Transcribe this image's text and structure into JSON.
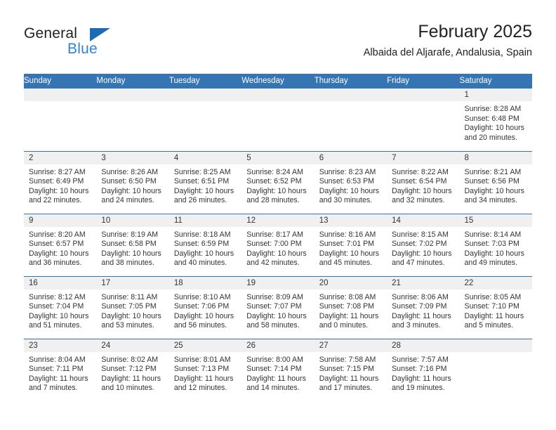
{
  "brand": {
    "name_dark": "General",
    "name_blue": "Blue",
    "accent_blue": "#3575b4",
    "logo_blue": "#2e83d2"
  },
  "header": {
    "title": "February 2025",
    "subtitle": "Albaida del Aljarafe, Andalusia, Spain"
  },
  "weekday_headers": [
    "Sunday",
    "Monday",
    "Tuesday",
    "Wednesday",
    "Thursday",
    "Friday",
    "Saturday"
  ],
  "labels": {
    "sunrise_prefix": "Sunrise:",
    "sunset_prefix": "Sunset:",
    "daylight_prefix": "Daylight:"
  },
  "weeks": [
    [
      {
        "day": "",
        "empty": true
      },
      {
        "day": "",
        "empty": true
      },
      {
        "day": "",
        "empty": true
      },
      {
        "day": "",
        "empty": true
      },
      {
        "day": "",
        "empty": true
      },
      {
        "day": "",
        "empty": true
      },
      {
        "day": "1",
        "sunrise": "Sunrise: 8:28 AM",
        "sunset": "Sunset: 6:48 PM",
        "daylight": "Daylight: 10 hours and 20 minutes."
      }
    ],
    [
      {
        "day": "2",
        "sunrise": "Sunrise: 8:27 AM",
        "sunset": "Sunset: 6:49 PM",
        "daylight": "Daylight: 10 hours and 22 minutes."
      },
      {
        "day": "3",
        "sunrise": "Sunrise: 8:26 AM",
        "sunset": "Sunset: 6:50 PM",
        "daylight": "Daylight: 10 hours and 24 minutes."
      },
      {
        "day": "4",
        "sunrise": "Sunrise: 8:25 AM",
        "sunset": "Sunset: 6:51 PM",
        "daylight": "Daylight: 10 hours and 26 minutes."
      },
      {
        "day": "5",
        "sunrise": "Sunrise: 8:24 AM",
        "sunset": "Sunset: 6:52 PM",
        "daylight": "Daylight: 10 hours and 28 minutes."
      },
      {
        "day": "6",
        "sunrise": "Sunrise: 8:23 AM",
        "sunset": "Sunset: 6:53 PM",
        "daylight": "Daylight: 10 hours and 30 minutes."
      },
      {
        "day": "7",
        "sunrise": "Sunrise: 8:22 AM",
        "sunset": "Sunset: 6:54 PM",
        "daylight": "Daylight: 10 hours and 32 minutes."
      },
      {
        "day": "8",
        "sunrise": "Sunrise: 8:21 AM",
        "sunset": "Sunset: 6:56 PM",
        "daylight": "Daylight: 10 hours and 34 minutes."
      }
    ],
    [
      {
        "day": "9",
        "sunrise": "Sunrise: 8:20 AM",
        "sunset": "Sunset: 6:57 PM",
        "daylight": "Daylight: 10 hours and 36 minutes."
      },
      {
        "day": "10",
        "sunrise": "Sunrise: 8:19 AM",
        "sunset": "Sunset: 6:58 PM",
        "daylight": "Daylight: 10 hours and 38 minutes."
      },
      {
        "day": "11",
        "sunrise": "Sunrise: 8:18 AM",
        "sunset": "Sunset: 6:59 PM",
        "daylight": "Daylight: 10 hours and 40 minutes."
      },
      {
        "day": "12",
        "sunrise": "Sunrise: 8:17 AM",
        "sunset": "Sunset: 7:00 PM",
        "daylight": "Daylight: 10 hours and 42 minutes."
      },
      {
        "day": "13",
        "sunrise": "Sunrise: 8:16 AM",
        "sunset": "Sunset: 7:01 PM",
        "daylight": "Daylight: 10 hours and 45 minutes."
      },
      {
        "day": "14",
        "sunrise": "Sunrise: 8:15 AM",
        "sunset": "Sunset: 7:02 PM",
        "daylight": "Daylight: 10 hours and 47 minutes."
      },
      {
        "day": "15",
        "sunrise": "Sunrise: 8:14 AM",
        "sunset": "Sunset: 7:03 PM",
        "daylight": "Daylight: 10 hours and 49 minutes."
      }
    ],
    [
      {
        "day": "16",
        "sunrise": "Sunrise: 8:12 AM",
        "sunset": "Sunset: 7:04 PM",
        "daylight": "Daylight: 10 hours and 51 minutes."
      },
      {
        "day": "17",
        "sunrise": "Sunrise: 8:11 AM",
        "sunset": "Sunset: 7:05 PM",
        "daylight": "Daylight: 10 hours and 53 minutes."
      },
      {
        "day": "18",
        "sunrise": "Sunrise: 8:10 AM",
        "sunset": "Sunset: 7:06 PM",
        "daylight": "Daylight: 10 hours and 56 minutes."
      },
      {
        "day": "19",
        "sunrise": "Sunrise: 8:09 AM",
        "sunset": "Sunset: 7:07 PM",
        "daylight": "Daylight: 10 hours and 58 minutes."
      },
      {
        "day": "20",
        "sunrise": "Sunrise: 8:08 AM",
        "sunset": "Sunset: 7:08 PM",
        "daylight": "Daylight: 11 hours and 0 minutes."
      },
      {
        "day": "21",
        "sunrise": "Sunrise: 8:06 AM",
        "sunset": "Sunset: 7:09 PM",
        "daylight": "Daylight: 11 hours and 3 minutes."
      },
      {
        "day": "22",
        "sunrise": "Sunrise: 8:05 AM",
        "sunset": "Sunset: 7:10 PM",
        "daylight": "Daylight: 11 hours and 5 minutes."
      }
    ],
    [
      {
        "day": "23",
        "sunrise": "Sunrise: 8:04 AM",
        "sunset": "Sunset: 7:11 PM",
        "daylight": "Daylight: 11 hours and 7 minutes."
      },
      {
        "day": "24",
        "sunrise": "Sunrise: 8:02 AM",
        "sunset": "Sunset: 7:12 PM",
        "daylight": "Daylight: 11 hours and 10 minutes."
      },
      {
        "day": "25",
        "sunrise": "Sunrise: 8:01 AM",
        "sunset": "Sunset: 7:13 PM",
        "daylight": "Daylight: 11 hours and 12 minutes."
      },
      {
        "day": "26",
        "sunrise": "Sunrise: 8:00 AM",
        "sunset": "Sunset: 7:14 PM",
        "daylight": "Daylight: 11 hours and 14 minutes."
      },
      {
        "day": "27",
        "sunrise": "Sunrise: 7:58 AM",
        "sunset": "Sunset: 7:15 PM",
        "daylight": "Daylight: 11 hours and 17 minutes."
      },
      {
        "day": "28",
        "sunrise": "Sunrise: 7:57 AM",
        "sunset": "Sunset: 7:16 PM",
        "daylight": "Daylight: 11 hours and 19 minutes."
      },
      {
        "day": "",
        "empty": true
      }
    ]
  ]
}
